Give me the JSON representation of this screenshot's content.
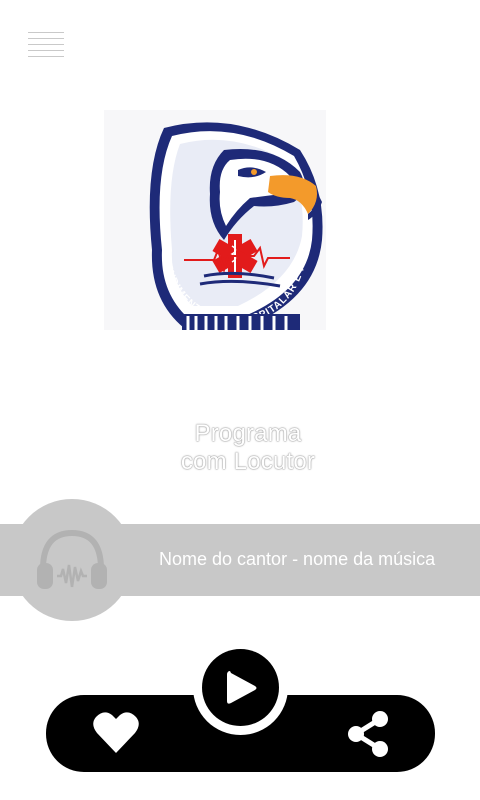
{
  "header": {
    "menu_icon": "hamburger-menu-icon"
  },
  "station": {
    "logo_icon": "eagle-star-of-life-logo",
    "logo_text": "ATENDIMENTO PRÉ-HOSPITALAR E RESGATE"
  },
  "program": {
    "line1": "Programa",
    "line2": "com Locutor"
  },
  "now_playing": {
    "track": "Nome do cantor - nome da música",
    "cover_icon": "headphones-icon"
  },
  "controls": {
    "like_icon": "heart-icon",
    "play_icon": "play-icon",
    "share_icon": "share-icon"
  },
  "colors": {
    "band": "#c8c8c8",
    "controls_bar": "#000000",
    "logo_navy": "#1e2a78",
    "logo_orange": "#f39a2b",
    "logo_red": "#e21b1b"
  }
}
